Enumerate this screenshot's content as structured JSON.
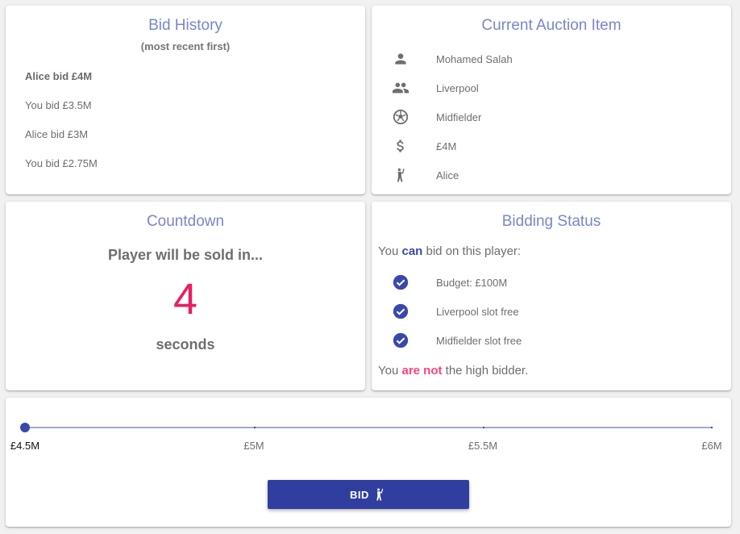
{
  "bid_history": {
    "title": "Bid History",
    "subtitle": "(most recent first)",
    "entries": [
      "Alice bid £4M",
      "You bid £3.5M",
      "Alice bid £3M",
      "You bid £2.75M"
    ]
  },
  "auction_item": {
    "title": "Current Auction Item",
    "rows": [
      {
        "icon": "person-icon",
        "text": "Mohamed Salah"
      },
      {
        "icon": "group-icon",
        "text": "Liverpool"
      },
      {
        "icon": "soccer-ball-icon",
        "text": "Midfielder"
      },
      {
        "icon": "dollar-icon",
        "text": "£4M"
      },
      {
        "icon": "raised-hand-person-icon",
        "text": "Alice"
      }
    ]
  },
  "countdown": {
    "title": "Countdown",
    "subtitle": "Player will be sold in...",
    "number": "4",
    "unit": "seconds"
  },
  "bidding_status": {
    "title": "Bidding Status",
    "can_prefix": "You ",
    "can_word": "can",
    "can_suffix": " bid on this player:",
    "checks": [
      "Budget: £100M",
      "Liverpool slot free",
      "Midfielder slot free"
    ],
    "high_prefix": "You ",
    "high_word": "are not",
    "high_suffix": " the high bidder."
  },
  "slider": {
    "ticks": [
      "£4.5M",
      "£5M",
      "£5.5M",
      "£6M"
    ],
    "value": "£4.5M"
  },
  "bid_button": {
    "label": "BID"
  },
  "colors": {
    "accent": "#7986cb",
    "primary": "#303f9f",
    "countdown": "#e91e63",
    "not": "#ff4081"
  }
}
